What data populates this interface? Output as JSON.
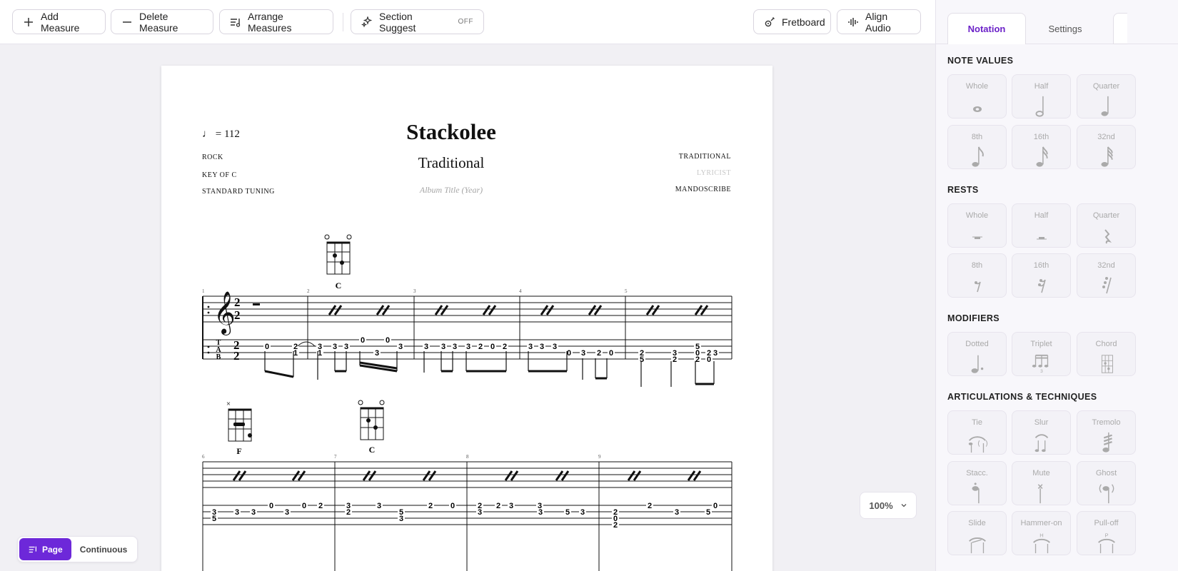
{
  "toolbar": {
    "add_measure": "Add Measure",
    "delete_measure": "Delete Measure",
    "arrange_measures": "Arrange Measures",
    "section_suggest": "Section Suggest",
    "section_suggest_state": "OFF",
    "fretboard": "Fretboard",
    "align_audio": "Align Audio"
  },
  "sheet": {
    "tempo_value": "112",
    "tempo_eq": "=",
    "style": "ROCK",
    "key": "KEY OF C",
    "tuning": "STANDARD TUNING",
    "title": "Stackolee",
    "composer": "Traditional",
    "album": "Album Title (Year)",
    "composer_right": "TRADITIONAL",
    "lyricist": "LYRICIST",
    "transcriber": "MANDOSCRIBE"
  },
  "score": {
    "chord_diagrams": [
      "C",
      "F",
      "C"
    ],
    "time_signature": [
      "2",
      "2"
    ],
    "tab_letters": [
      "T",
      "A",
      "B"
    ],
    "row1_measures": [
      "1",
      "2",
      "3",
      "4",
      "5"
    ],
    "row2_measures": [
      "6",
      "7",
      "8",
      "9"
    ],
    "tab_numbers_row1": [
      "0",
      "2",
      "1",
      "3",
      "1",
      "3",
      "3",
      "0",
      "3",
      "0",
      "3",
      "3",
      "3",
      "3",
      "3",
      "2",
      "0",
      "2",
      "3",
      "3",
      "3",
      "0",
      "3",
      "2",
      "0",
      "2",
      "5",
      "3",
      "2",
      "0",
      "2",
      "2",
      "0",
      "5",
      "3"
    ],
    "tab_numbers_row2": [
      "3",
      "5",
      "3",
      "3",
      "0",
      "3",
      "0",
      "2",
      "3",
      "2",
      "3",
      "5",
      "3",
      "2",
      "0",
      "2",
      "3",
      "2",
      "3",
      "3",
      "5",
      "3",
      "2",
      "0",
      "2",
      "3",
      "5",
      "0",
      "2",
      "3"
    ]
  },
  "sidebar": {
    "tabs": [
      "Notation",
      "Settings"
    ],
    "active_tab": "Notation",
    "note_values_title": "NOTE VALUES",
    "note_values": [
      "Whole",
      "Half",
      "Quarter",
      "8th",
      "16th",
      "32nd"
    ],
    "rests_title": "RESTS",
    "rests": [
      "Whole",
      "Half",
      "Quarter",
      "8th",
      "16th",
      "32nd"
    ],
    "modifiers_title": "MODIFIERS",
    "modifiers": [
      "Dotted",
      "Triplet",
      "Chord"
    ],
    "articulations_title": "ARTICULATIONS & TECHNIQUES",
    "articulations": [
      "Tie",
      "Slur",
      "Tremolo",
      "Stacc.",
      "Mute",
      "Ghost",
      "Slide",
      "Hammer-on",
      "Pull-off"
    ]
  },
  "view": {
    "page": "Page",
    "continuous": "Continuous",
    "active": "Page"
  },
  "zoom": {
    "value": "100%"
  },
  "colors": {
    "accent": "#6d28d9",
    "sheet": "#ffffff",
    "canvas": "#f1f0f4"
  }
}
